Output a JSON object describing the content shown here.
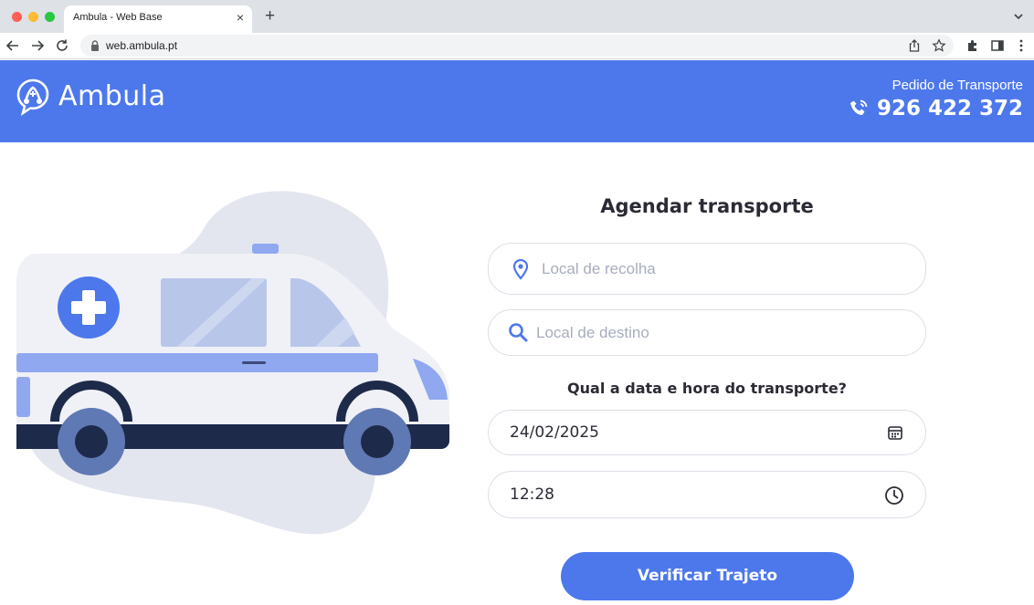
{
  "browser": {
    "tab_title": "Ambula - Web Base",
    "tab_close": "×",
    "new_tab": "+",
    "url": "web.ambula.pt"
  },
  "header": {
    "logo_text": "Ambula",
    "contact_label": "Pedido de Transporte",
    "phone": "926 422 372",
    "brand_color": "#4d78ec"
  },
  "form": {
    "title": "Agendar transporte",
    "pickup": {
      "placeholder": "Local de recolha",
      "icon": "location-pin-icon"
    },
    "destination": {
      "placeholder": "Local de destino",
      "icon": "search-icon"
    },
    "question": "Qual a data e hora do transporte?",
    "date": {
      "value": "24/02/2025",
      "icon": "calendar-icon"
    },
    "time": {
      "value": "12:28",
      "icon": "clock-icon"
    },
    "submit_label": "Verificar Trajeto"
  },
  "illustration": {
    "subject": "ambulance-illustration"
  }
}
